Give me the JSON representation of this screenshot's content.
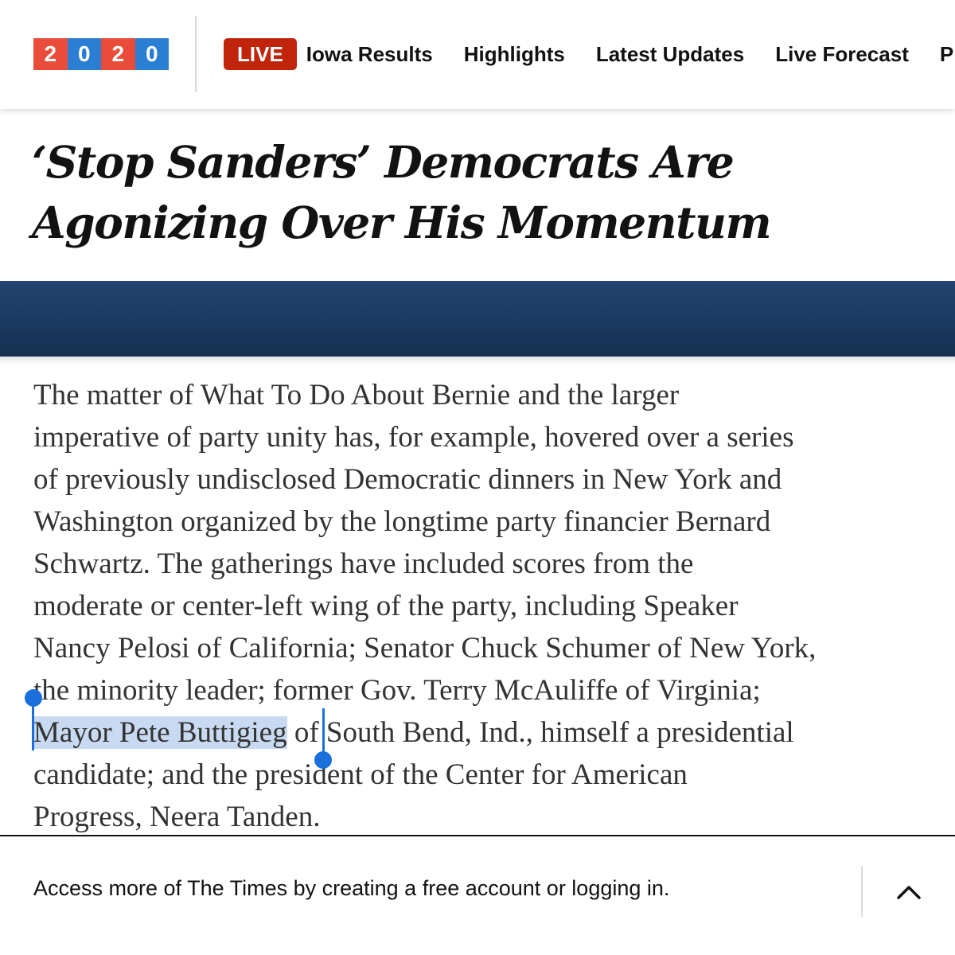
{
  "header": {
    "logo": {
      "digits": [
        "2",
        "0",
        "2",
        "0"
      ],
      "colors": [
        "#ea4c3a",
        "#2a7fd4",
        "#ea4c3a",
        "#2a7fd4"
      ]
    },
    "live_label": "LIVE",
    "nav_items": [
      "Iowa Results",
      "Highlights",
      "Latest Updates",
      "Live Forecast",
      "Preci"
    ]
  },
  "article": {
    "headline_line1": "‘Stop Sanders’ Democrats Are",
    "headline_line2": "Agonizing Over His Momentum",
    "body_lines": [
      "The matter of What To Do About Bernie and the larger",
      "imperative of party unity has, for example, hovered over a series",
      "of previously undisclosed Democratic dinners in New York and",
      "Washington organized by the longtime party financier Bernard",
      "Schwartz. The gatherings have included scores from the",
      "moderate or center-left wing of the party, including Speaker",
      "Nancy Pelosi of California; Senator Chuck Schumer of New York,",
      "the minority leader; former Gov. Terry McAuliffe of Virginia;"
    ],
    "selected_text": "Mayor Pete Buttigieg",
    "line9_rest": " of South Bend, Ind., himself a presidential",
    "body_line10": "candidate; and the president of the Center for American",
    "body_line11": "Progress, Neera Tanden."
  },
  "footer": {
    "prompt": "Access more of The Times by creating a free account or logging in.",
    "toggle_icon": "chevron-up-icon"
  },
  "colors": {
    "live_badge": "#c0240b",
    "hero_band": "#1d3b64",
    "selection_highlight": "#c8daf1",
    "selection_handle": "#1a6fdc"
  }
}
